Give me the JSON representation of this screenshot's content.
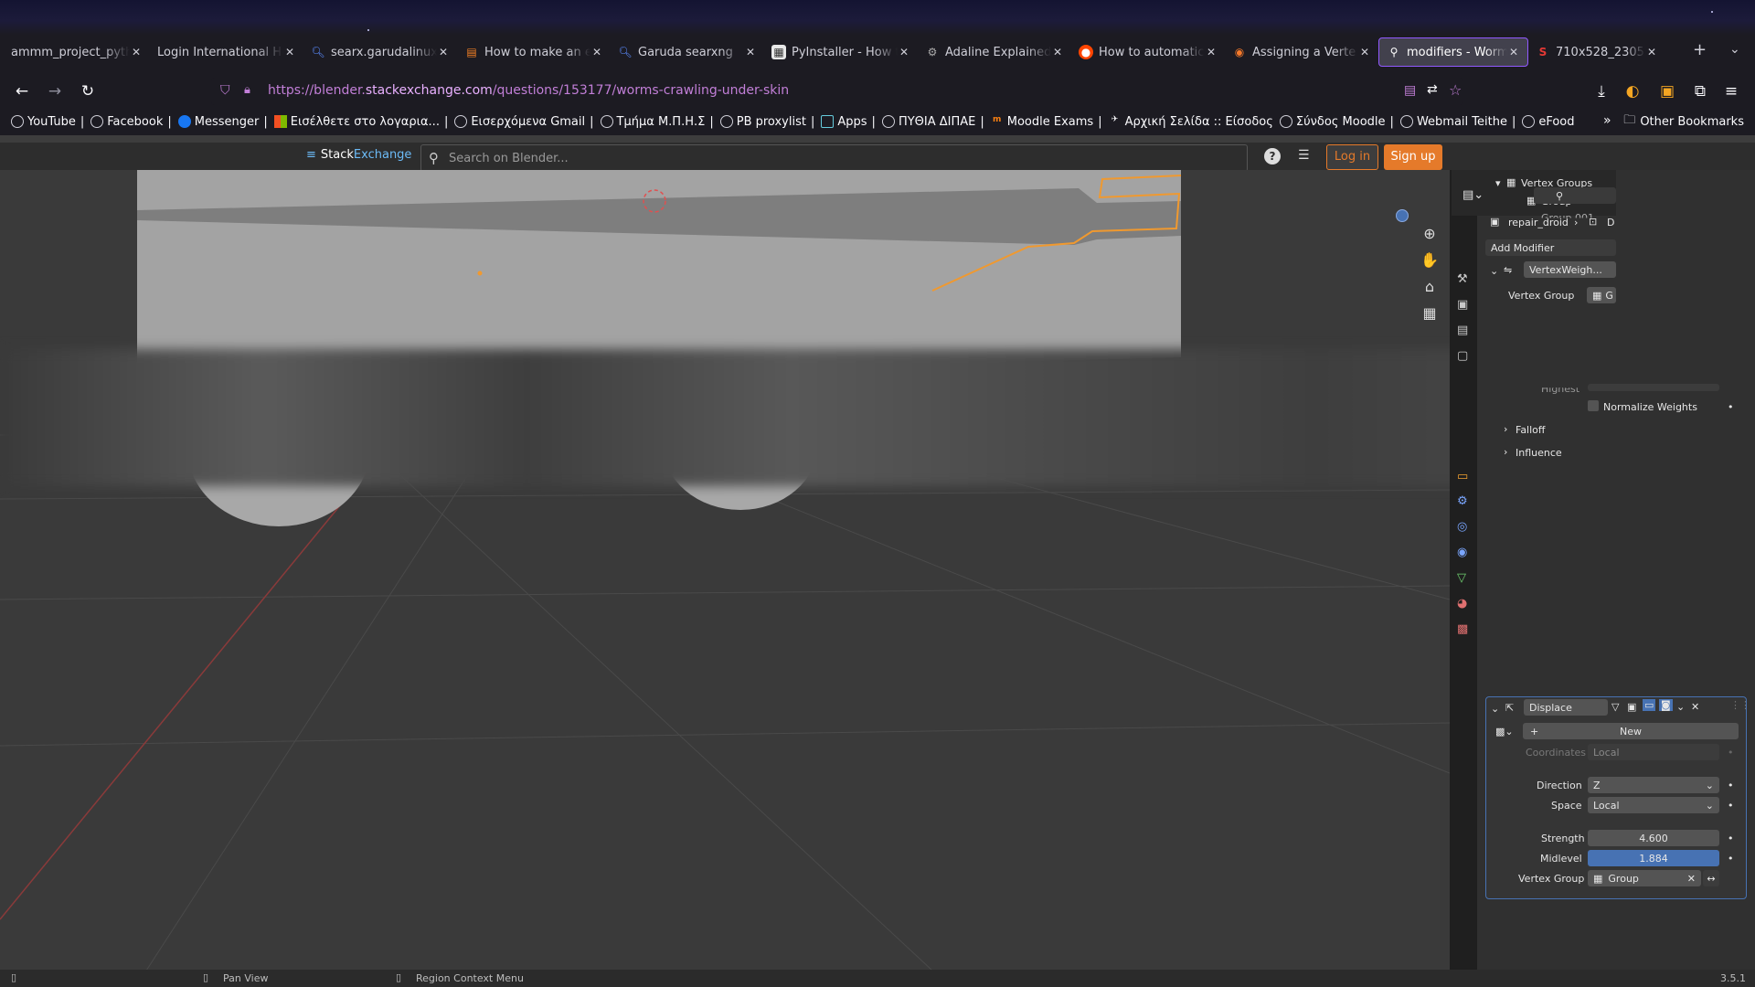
{
  "tabs": [
    {
      "label": "ammm_project_pytho",
      "icon": "none"
    },
    {
      "label": "Login International He",
      "icon": "none"
    },
    {
      "label": "searx.garudalinux.",
      "icon": "search-icon"
    },
    {
      "label": "How to make an e",
      "icon": "stackexchange-icon"
    },
    {
      "label": "Garuda searxng",
      "icon": "search-icon"
    },
    {
      "label": "PyInstaller - How t",
      "icon": "page-icon"
    },
    {
      "label": "Adaline Explained",
      "icon": "gear-icon"
    },
    {
      "label": "How to automatic",
      "icon": "reddit-icon"
    },
    {
      "label": "Assigning a Verte",
      "icon": "blender-icon"
    },
    {
      "label": "modifiers - Worms",
      "icon": "stackexchange-icon",
      "active": true
    },
    {
      "label": "710x528_2305203!",
      "icon": "image-icon"
    }
  ],
  "url": {
    "prefix": "https://blender.",
    "domain": "stackexchange.com",
    "path": "/questions/153177/worms-crawling-under-skin"
  },
  "bookmarks": [
    "YouTube",
    "Facebook",
    "Messenger",
    "Εισέλθετε στο λογαρια...",
    "Εισερχόμενα Gmail",
    "Τμήμα Μ.Π.Η.Σ",
    "PB proxylist",
    "Apps",
    "ΠΥΘΙΑ ΔΙΠΑΕ",
    "Moodle Exams",
    "Αρχική Σελίδα :: Είσοδος",
    "Σύνδος Moodle",
    "Webmail Teithe",
    "eFood"
  ],
  "other_bookmarks": "Other Bookmarks",
  "se": {
    "brand_stack": "Stack",
    "brand_exchange": "Exchange",
    "search_placeholder": "Search on Blender...",
    "login": "Log in",
    "signup": "Sign up"
  },
  "outliner": {
    "vertex_groups": "Vertex Groups",
    "group": "Group",
    "group2": "Group.001"
  },
  "props": {
    "object_name": "repair_droid",
    "breadcrumb_next": "D",
    "add_modifier": "Add Modifier",
    "vw_modifier_name": "VertexWeigh...",
    "vw_vertex_group_label": "Vertex Group",
    "vw_vertex_group_value": "G",
    "highest_label": "Highest",
    "normalize_weights": "Normalize Weights",
    "falloff": "Falloff",
    "influence": "Influence",
    "displace_name": "Displace",
    "new_label": "New",
    "coordinates_label": "Coordinates",
    "coordinates_value": "Local",
    "direction_label": "Direction",
    "direction_value": "Z",
    "space_label": "Space",
    "space_value": "Local",
    "strength_label": "Strength",
    "strength_value": "4.600",
    "midlevel_label": "Midlevel",
    "midlevel_value": "1.884",
    "dvg_label": "Vertex Group",
    "dvg_value": "Group"
  },
  "status": {
    "pan_view": "Pan View",
    "region_menu": "Region Context Menu",
    "version": "3.5.1"
  },
  "colors": {
    "accent": "#9059ff",
    "blender_blue": "#4772b3",
    "se_orange": "#e57a2a",
    "selection_orange": "#f0992f"
  }
}
